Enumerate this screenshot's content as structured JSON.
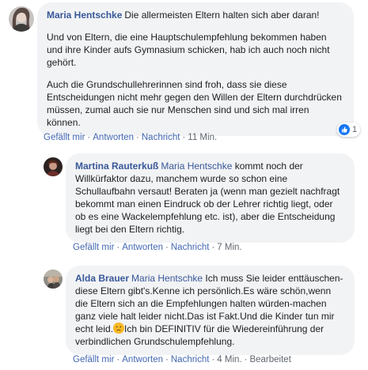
{
  "comments": [
    {
      "author": "Maria Hentschke",
      "paragraphs": [
        "Die allermeisten Eltern halten sich aber daran!",
        "Und von Eltern, die eine Hauptschulempfehlung bekommen haben und ihre Kinder aufs Gymnasium schicken, hab ich auch noch nicht gehört.",
        "Auch die Grundschullehrerinnen sind froh, dass sie diese Entscheidungen nicht mehr gegen den Willen der Eltern durchdrücken müssen, zumal auch sie nur Menschen sind und sich mal irren können."
      ],
      "reaction_count": "1",
      "actions": {
        "like": "Gefällt mir",
        "reply": "Antworten",
        "message": "Nachricht",
        "time": "11 Min."
      }
    },
    {
      "author": "Martina Rauterkuß",
      "mention": "Maria Hentschke",
      "text": "kommt noch der Willkürfaktor dazu, manchem wurde so schon eine Schullaufbahn versaut! Beraten ja (wenn man gezielt nachfragt bekommt man einen Eindruck ob der Lehrer richtig liegt, oder ob es eine Wackelempfehlung etc. ist), aber die Entscheidung liegt bei den Eltern richtig.",
      "actions": {
        "like": "Gefällt mir",
        "reply": "Antworten",
        "message": "Nachricht",
        "time": "7 Min."
      }
    },
    {
      "author": "Alda Brauer",
      "mention": "Maria Hentschke",
      "text_before_emoji": "Ich muss Sie leider enttäuschen-diese Eltern gibt's.Kenne ich persönlich.Es wäre schön,wenn die Eltern sich an die Empfehlungen halten würden-machen ganz viele halt leider nicht.Das ist Fakt.Und die Kinder tun mir echt leid.",
      "text_after_emoji": "Ich bin DEFINITIV für die Wiedereinführung der verbindlichen Grundschulempfehlung.",
      "actions": {
        "like": "Gefällt mir",
        "reply": "Antworten",
        "message": "Nachricht",
        "time": "4 Min.",
        "edited": "Bearbeitet"
      }
    }
  ],
  "icons": {
    "reaction": "like-icon",
    "emoji": "sad-face-emoji"
  },
  "colors": {
    "link": "#385898",
    "action_link": "#4267b2",
    "bubble": "#f2f3f5",
    "like": "#1877f2"
  }
}
